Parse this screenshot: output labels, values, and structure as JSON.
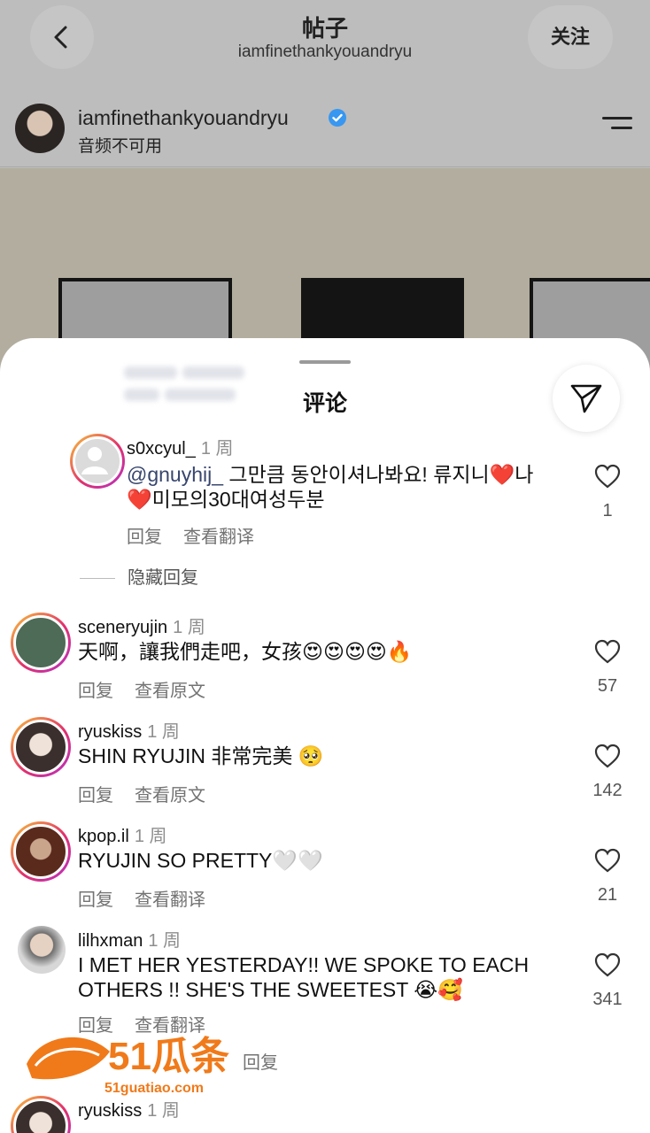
{
  "header": {
    "title": "帖子",
    "subtitle": "iamfinethankyouandryu",
    "follow_label": "关注"
  },
  "author": {
    "username": "iamfinethankyouandryu",
    "subtitle": "音频不可用"
  },
  "sheet": {
    "title": "评论"
  },
  "comments": [
    {
      "username": "s0xcyul_",
      "time": "1 周",
      "mention": "@gnuyhij_",
      "text": " 그만큼 동안이셔나봐요! 류지니❤️나",
      "text2": "❤️미모의30대여성두분",
      "reply": "回复",
      "translate": "查看翻译",
      "likes": "1"
    },
    {
      "username": "sceneryujin",
      "time": "1 周",
      "text": "天啊，讓我們走吧，女孩😍😍😍😍🔥",
      "reply": "回复",
      "translate": "查看原文",
      "likes": "57"
    },
    {
      "username": "ryuskiss",
      "time": "1 周",
      "text": "SHIN RYUJIN 非常完美 🥺",
      "reply": "回复",
      "translate": "查看原文",
      "likes": "142"
    },
    {
      "username": "kpop.il",
      "time": "1 周",
      "text": "RYUJIN SO PRETTY🤍🤍",
      "reply": "回复",
      "translate": "查看翻译",
      "likes": "21"
    },
    {
      "username": "lilhxman",
      "time": "1 周",
      "text": "I MET HER YESTERDAY!! WE SPOKE TO EACH",
      "text2": "OTHERS !! SHE'S THE SWEETEST 😭🥰",
      "reply": "回复",
      "translate": "查看翻译",
      "likes": "341",
      "more_replies": "回复"
    },
    {
      "username": "ryuskiss",
      "time": "1 周"
    }
  ],
  "hidden_replies": "隐藏回复",
  "watermark": {
    "brand": "51瓜条",
    "url": "51guatiao.com"
  },
  "colors": {
    "mention": "#37456e",
    "ring_start": "#f9c536",
    "ring_end": "#b532c7",
    "verified": "#3897f0"
  }
}
